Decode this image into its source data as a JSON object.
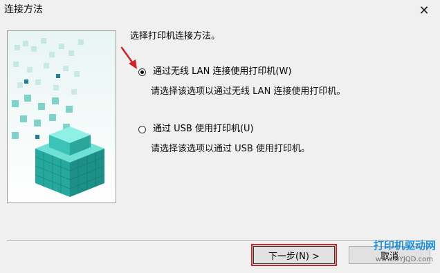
{
  "window": {
    "title": "连接方法",
    "close_icon": "close-icon"
  },
  "main": {
    "prompt": "选择打印机连接方法。",
    "options": [
      {
        "label": "通过无线 LAN 连接使用打印机(W)",
        "description": "请选择该选项以通过无线 LAN 连接使用打印机。",
        "selected": true
      },
      {
        "label": "通过 USB 使用打印机(U)",
        "description": "请选择该选项以通过 USB 使用打印机。",
        "selected": false
      }
    ]
  },
  "footer": {
    "next_label": "下一步(N) >",
    "cancel_label": "取消"
  },
  "watermark": {
    "text": "打印机驱动网",
    "sub": "www.DYJQD.com"
  },
  "colors": {
    "accent_red": "#d32020",
    "art_teal": "#2bb3a8",
    "watermark_blue": "#1a8fdb"
  }
}
